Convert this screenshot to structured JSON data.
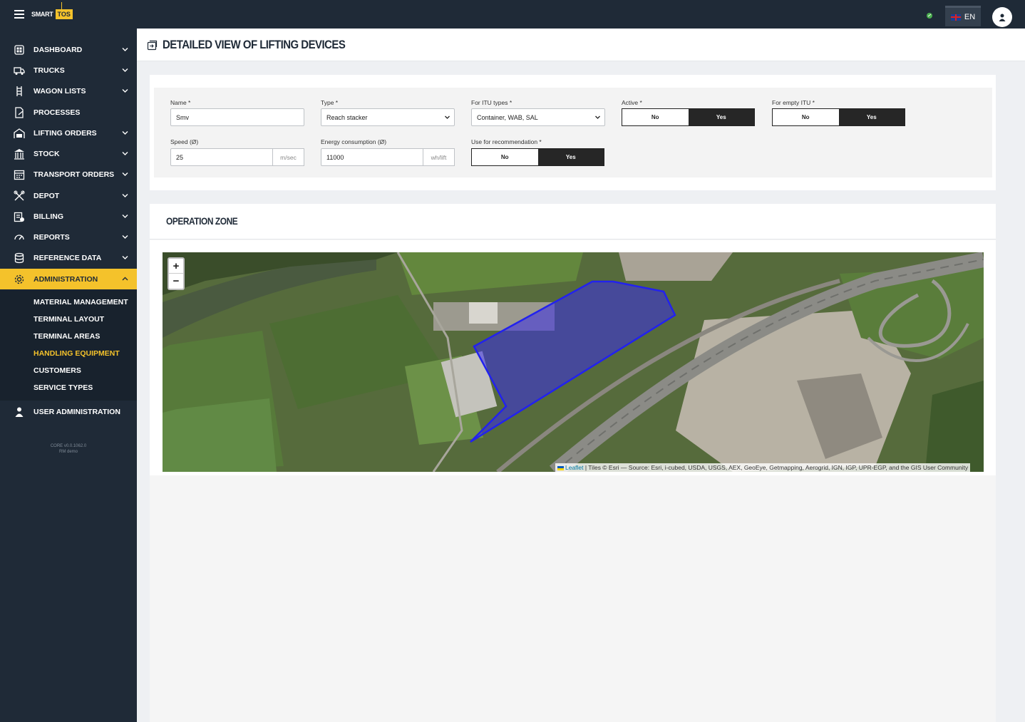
{
  "app": {
    "logo_smart": "SMART",
    "logo_tos": "TOS"
  },
  "topbar": {
    "language": "EN"
  },
  "sidebar": {
    "items": [
      {
        "label": "DASHBOARD",
        "icon": "dashboard-icon",
        "expandable": true
      },
      {
        "label": "TRUCKS",
        "icon": "truck-icon",
        "expandable": true
      },
      {
        "label": "WAGON LISTS",
        "icon": "wagon-icon",
        "expandable": true
      },
      {
        "label": "PROCESSES",
        "icon": "process-icon",
        "expandable": false
      },
      {
        "label": "LIFTING ORDERS",
        "icon": "lifting-icon",
        "expandable": true
      },
      {
        "label": "STOCK",
        "icon": "stock-icon",
        "expandable": true
      },
      {
        "label": "TRANSPORT ORDERS",
        "icon": "calendar-icon",
        "expandable": true
      },
      {
        "label": "DEPOT",
        "icon": "tools-icon",
        "expandable": true
      },
      {
        "label": "BILLING",
        "icon": "billing-icon",
        "expandable": true
      },
      {
        "label": "REPORTS",
        "icon": "gauge-icon",
        "expandable": true
      },
      {
        "label": "REFERENCE DATA",
        "icon": "database-icon",
        "expandable": true
      },
      {
        "label": "ADMINISTRATION",
        "icon": "gear-icon",
        "expandable": true,
        "active": true
      }
    ],
    "subitems": [
      {
        "label": "MATERIAL MANAGEMENT"
      },
      {
        "label": "TERMINAL LAYOUT"
      },
      {
        "label": "TERMINAL AREAS"
      },
      {
        "label": "HANDLING EQUIPMENT",
        "current": true
      },
      {
        "label": "CUSTOMERS"
      },
      {
        "label": "SERVICE TYPES"
      }
    ],
    "user_admin": "USER ADMINISTRATION",
    "version_line1": "CORE v0.0.1062.0",
    "version_line2": "RM demo"
  },
  "page": {
    "title": "DETAILED VIEW OF LIFTING DEVICES"
  },
  "form": {
    "name": {
      "label": "Name *",
      "value": "Smv"
    },
    "type": {
      "label": "Type *",
      "value": "Reach stacker"
    },
    "itu_types": {
      "label": "For ITU types *",
      "value": "Container, WAB, SAL"
    },
    "active": {
      "label": "Active *",
      "no": "No",
      "yes": "Yes",
      "selected": "Yes"
    },
    "empty_itu": {
      "label": "For empty ITU *",
      "no": "No",
      "yes": "Yes",
      "selected": "Yes"
    },
    "speed": {
      "label": "Speed (Ø)",
      "value": "25",
      "unit": "m/sec"
    },
    "energy": {
      "label": "Energy consumption (Ø)",
      "value": "11000",
      "unit": "wh/lift"
    },
    "recommendation": {
      "label": "Use for recommendation *",
      "no": "No",
      "yes": "Yes",
      "selected": "Yes"
    }
  },
  "zone": {
    "title": "OPERATION ZONE",
    "zoom_in": "+",
    "zoom_out": "−",
    "attribution_leaflet": "Leaflet",
    "attribution_rest": " | Tiles © Esri — Source: Esri, i-cubed, USDA, USGS, AEX, GeoEye, Getmapping, Aerogrid, IGN, IGP, UPR-EGP, and the GIS User Community"
  },
  "colors": {
    "sidebar_bg": "#1f2a37",
    "accent": "#f4c22b",
    "polygon": "#3b2ee8"
  }
}
